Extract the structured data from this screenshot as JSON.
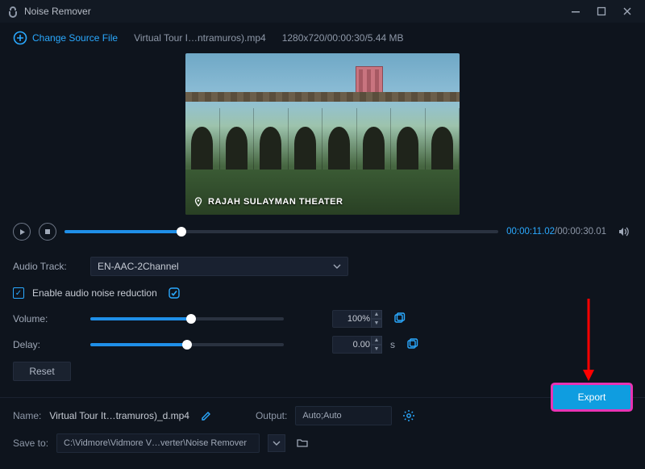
{
  "titlebar": {
    "title": "Noise Remover"
  },
  "toolbar": {
    "change_source_label": "Change Source File",
    "filename": "Virtual Tour I…ntramuros).mp4",
    "meta": "1280x720/00:00:30/5.44 MB"
  },
  "preview": {
    "caption": "RAJAH SULAYMAN THEATER"
  },
  "playbar": {
    "seek_percent": 27,
    "current_time": "00:00:11.02",
    "duration": "00:00:30.01"
  },
  "audio": {
    "track_label": "Audio Track:",
    "track_value": "EN-AAC-2Channel",
    "noise_label": "Enable audio noise reduction",
    "noise_checked": true,
    "volume_label": "Volume:",
    "volume_display": "100%",
    "volume_percent": 100,
    "delay_label": "Delay:",
    "delay_display": "0.00",
    "delay_unit": "s",
    "delay_percent": 50,
    "reset_label": "Reset"
  },
  "output": {
    "name_label": "Name:",
    "name_value": "Virtual Tour It…tramuros)_d.mp4",
    "output_label": "Output:",
    "output_value": "Auto;Auto",
    "saveto_label": "Save to:",
    "saveto_value": "C:\\Vidmore\\Vidmore V…verter\\Noise Remover",
    "export_label": "Export"
  },
  "colors": {
    "accent": "#2aa9ff",
    "highlight": "#e833b3",
    "primary_btn": "#0f9de0"
  }
}
